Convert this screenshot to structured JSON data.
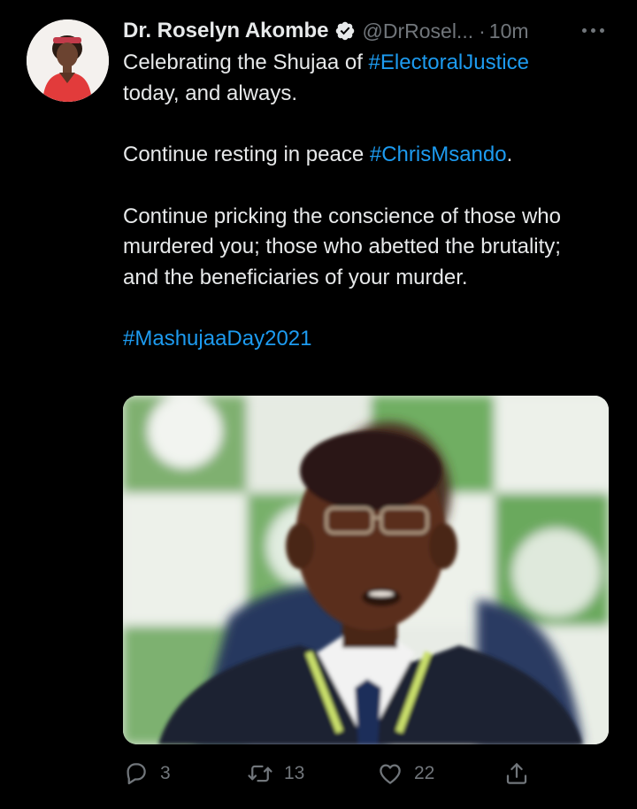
{
  "author": {
    "name": "Dr. Roselyn Akombe",
    "handle": "@DrRosel...",
    "separator": "·",
    "time": "10m",
    "verified": true
  },
  "icons": {
    "verified": "verified-badge-icon",
    "more": "more-options-icon",
    "reply": "reply-icon",
    "retweet": "retweet-icon",
    "like": "like-icon",
    "share": "share-icon"
  },
  "tweet": {
    "line1_text": "Celebrating the Shujaa of ",
    "line1_tag": "#ElectoralJustice",
    "line2_text": "today, and always.",
    "para2_text": "Continue resting in peace ",
    "para2_tag": "#ChrisMsando",
    "para2_end": ".",
    "para3_text": "Continue pricking the conscience of those who murdered you; those who abetted the brutality; and the beneficiaries of your murder.",
    "para4_tag": "#MashujaaDay2021"
  },
  "actions": {
    "replies": "3",
    "retweets": "13",
    "likes": "22"
  },
  "colors": {
    "background": "#000000",
    "text": "#e7e9ea",
    "secondary": "#71767b",
    "link": "#1d9bf0"
  }
}
